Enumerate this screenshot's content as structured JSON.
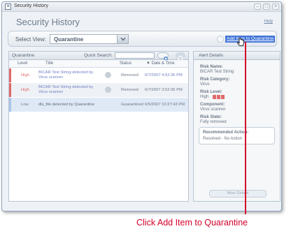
{
  "window": {
    "title": "Security History"
  },
  "page": {
    "title": "Security History",
    "help": "Help"
  },
  "view": {
    "label": "Select View:",
    "selected": "Quarantine"
  },
  "actions": {
    "add_to_quarantine": "Add Item to Quarantine"
  },
  "quarantine": {
    "panel_title": "Quarantine",
    "quick_search_label": "Quick Search:",
    "search_value": "",
    "columns": {
      "level": "Level",
      "title": "Title",
      "status": "Status",
      "date": "▼ Date & Time"
    },
    "rows": [
      {
        "level": "High",
        "title_line1": "BICAR Test String detected by",
        "title_line2": "Virus scanner",
        "status": "Removed",
        "date": "6/7/2007 4:52:36 PM",
        "bar_color": "#e06a6a"
      },
      {
        "level": "High",
        "title_line1": "BICAR Test String detected by",
        "title_line2": "Virus scanner",
        "status": "Removed",
        "date": "6/7/2007 3:52:36 PM",
        "bar_color": "#e06a6a"
      },
      {
        "level": "Low",
        "title_line1": "dls_file detected by Quarantine",
        "title_line2": "",
        "status": "Guarantined",
        "date": "6/5/2007 10:27:43 PM",
        "bar_color": "#a9c6e8"
      }
    ]
  },
  "alert_details": {
    "panel_title": "Alert Details",
    "risk_name_label": "Risk Name:",
    "risk_name": "BICAR Test String",
    "risk_category_label": "Risk Category:",
    "risk_category": "Virus",
    "risk_level_label": "Risk Level:",
    "risk_level": "High",
    "component_label": "Component:",
    "component": "Virus scanner",
    "risk_state_label": "Risk State:",
    "risk_state": "Fully removed",
    "recommended_label": "Recommended Action:",
    "recommended": "Resolved - No Action",
    "more_details": "More Details"
  },
  "annotation": {
    "text": "Click Add Item to Quarantine"
  },
  "colors": {
    "accent": "#3f73d8",
    "callout": "#d4002a",
    "high": "#e06a6a",
    "low_bar": "#a9c6e8"
  }
}
